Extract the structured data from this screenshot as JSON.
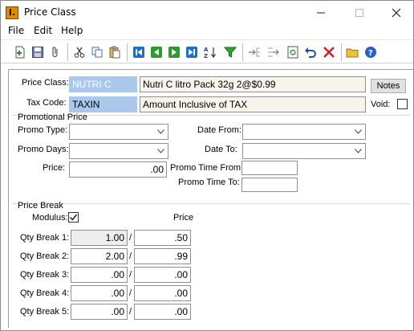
{
  "window": {
    "title": "Price Class",
    "app_icon_text": "I."
  },
  "menu": {
    "file": "File",
    "edit": "Edit",
    "help": "Help"
  },
  "toolbar": {
    "icons": [
      "new-icon",
      "save-icon",
      "attach-icon",
      "cut-icon",
      "copy-icon",
      "paste-icon",
      "first-record-icon",
      "previous-record-icon",
      "next-record-icon",
      "last-record-icon",
      "sort-icon",
      "filter-icon",
      "insert-row-icon",
      "delete-row-icon",
      "refresh-icon",
      "undo-icon",
      "delete-icon",
      "open-folder-icon",
      "help-icon"
    ]
  },
  "form": {
    "price_class_label": "Price Class:",
    "price_class_code": "NUTRI C",
    "price_class_desc": "Nutri C litro Pack 32g 2@$0.99",
    "notes_button": "Notes",
    "tax_code_label": "Tax Code:",
    "tax_code": "TAXIN",
    "tax_code_desc": "Amount Inclusive of TAX",
    "void_label": "Void:",
    "void_checked": false
  },
  "promo": {
    "section_title": "Promotional Price",
    "promo_type_label": "Promo Type:",
    "promo_type_value": "",
    "promo_days_label": "Promo Days:",
    "promo_days_value": "",
    "price_label": "Price:",
    "price_value": ".00",
    "date_from_label": "Date From:",
    "date_from_value": "",
    "date_to_label": "Date To:",
    "date_to_value": "",
    "time_from_label": "Promo Time From:",
    "time_from_value": "",
    "time_to_label": "Promo Time To:",
    "time_to_value": ""
  },
  "price_break": {
    "section_title": "Price Break",
    "modulus_label": "Modulus:",
    "modulus_checked": true,
    "price_header": "Price",
    "rows": [
      {
        "label": "Qty Break 1:",
        "qty": "1.00",
        "price": ".50"
      },
      {
        "label": "Qty Break 2:",
        "qty": "2.00",
        "price": ".99"
      },
      {
        "label": "Qty Break 3:",
        "qty": ".00",
        "price": ".00"
      },
      {
        "label": "Qty Break 4:",
        "qty": ".00",
        "price": ".00"
      },
      {
        "label": "Qty Break 5:",
        "qty": ".00",
        "price": ".00"
      }
    ],
    "slash": "/"
  }
}
